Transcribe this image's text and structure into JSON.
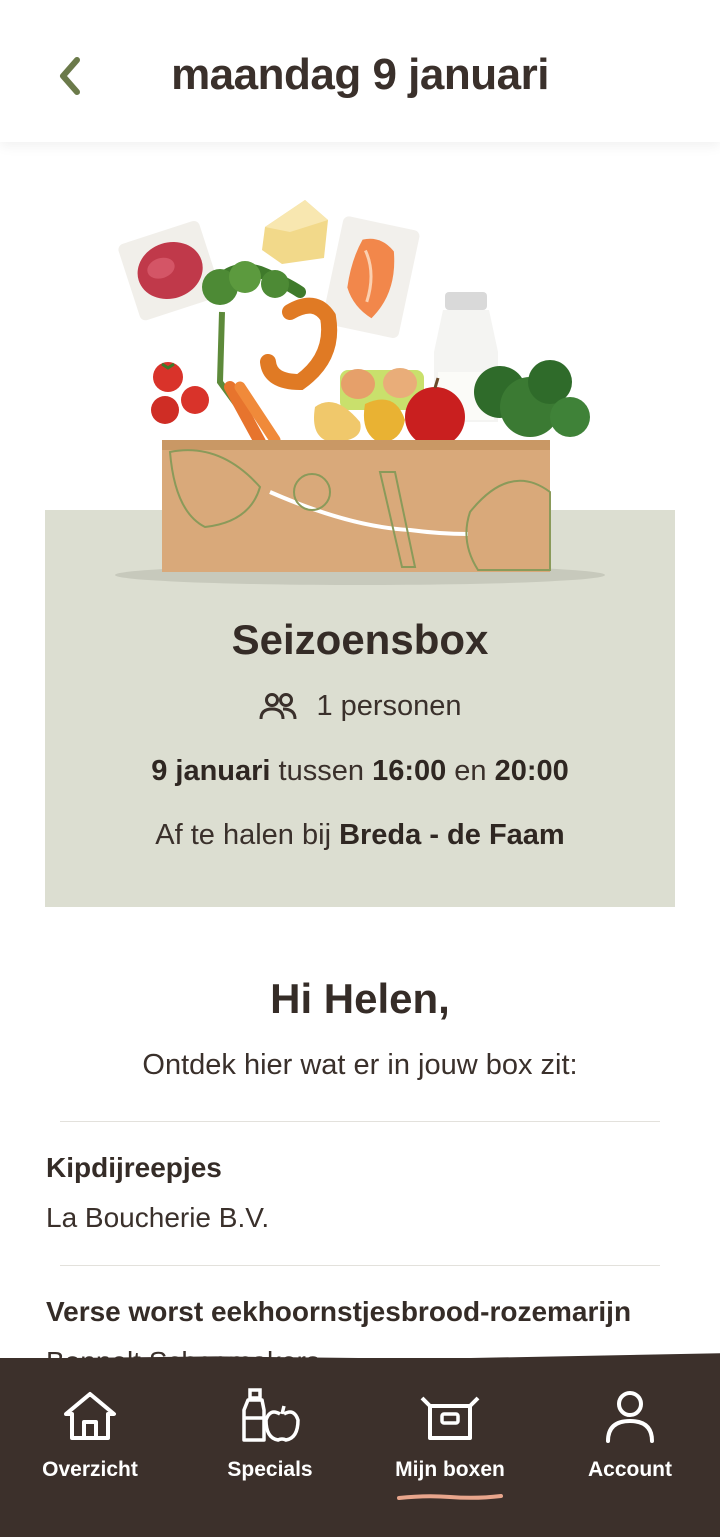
{
  "header": {
    "title": "maandag 9 januari",
    "accent_color": "#6b7a4a"
  },
  "box": {
    "name": "Seizoensbox",
    "persons": "1 personen",
    "delivery_date": "9 januari",
    "between": "tussen",
    "time_from": "16:00",
    "and": "en",
    "time_to": "20:00",
    "pickup_prefix": "Af te halen bij",
    "pickup_location": "Breda - de Faam",
    "panel_color": "#dcded1"
  },
  "greeting": {
    "title": "Hi Helen,",
    "subtitle": "Ontdek hier wat er in jouw box zit:"
  },
  "items": [
    {
      "name": "Kipdijreepjes",
      "vendor": "La Boucherie B.V."
    },
    {
      "name": "Verse worst eekhoornstjesbrood-rozemarijn",
      "vendor": "Bonnelt Schoemakers"
    }
  ],
  "nav": {
    "background": "#3c302b",
    "active_underline_color": "#e8a58c",
    "items": [
      {
        "label": "Overzicht",
        "icon": "home-icon",
        "active": false
      },
      {
        "label": "Specials",
        "icon": "groceries-icon",
        "active": false
      },
      {
        "label": "Mijn boxen",
        "icon": "box-icon",
        "active": true
      },
      {
        "label": "Account",
        "icon": "person-icon",
        "active": false
      }
    ]
  }
}
